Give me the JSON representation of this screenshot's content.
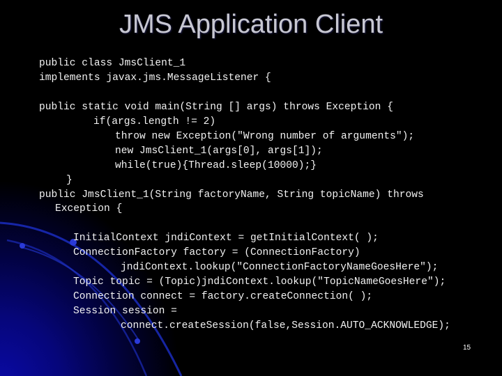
{
  "slide": {
    "title": "JMS Application Client",
    "page_number": "15",
    "code_lines": [
      "public class JmsClient_1",
      "implements javax.jms.MessageListener {",
      "public static void main(String [] args) throws Exception {",
      "if(args.length != 2)",
      "throw new Exception(\"Wrong number of arguments\");",
      "new JmsClient_1(args[0], args[1]);",
      "while(true){Thread.sleep(10000);}",
      "}",
      "public JmsClient_1(String factoryName, String topicName) throws",
      "Exception {",
      "InitialContext jndiContext = getInitialContext( );",
      "ConnectionFactory factory = (ConnectionFactory)",
      "jndiContext.lookup(\"ConnectionFactoryNameGoesHere\");",
      "Topic topic = (Topic)jndiContext.lookup(\"TopicNameGoesHere\");",
      "Connection connect = factory.createConnection( );",
      "Session session =",
      "connect.createSession(false,Session.AUTO_ACKNOWLEDGE);"
    ]
  },
  "colors": {
    "background": "#000000",
    "title": "#c8c8d2",
    "code_text": "#f2f2f2",
    "accent_glow": "#0a0aa8"
  }
}
